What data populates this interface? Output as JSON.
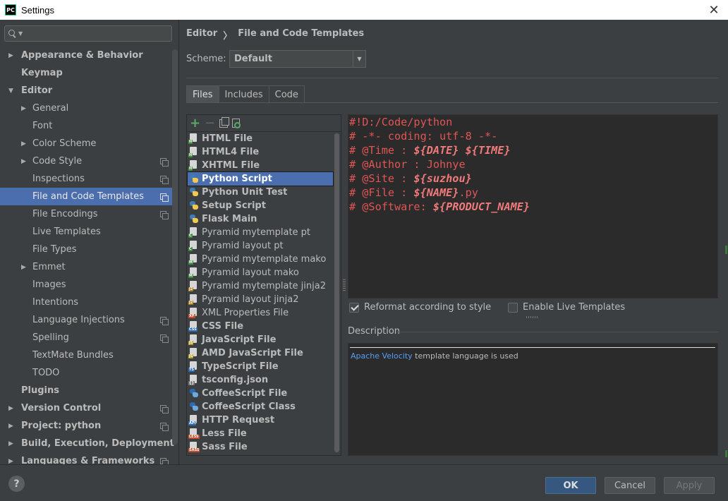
{
  "window": {
    "app_icon": "PC",
    "title": "Settings",
    "close_glyph": "✕"
  },
  "sidebar": {
    "search_placeholder": "",
    "items": [
      {
        "label": "Appearance & Behavior",
        "arrow": "▶"
      },
      {
        "label": "Keymap"
      },
      {
        "label": "Editor",
        "arrow": "▼"
      },
      {
        "label": "General",
        "arrow": "▶"
      },
      {
        "label": "Font"
      },
      {
        "label": "Color Scheme",
        "arrow": "▶"
      },
      {
        "label": "Code Style",
        "arrow": "▶"
      },
      {
        "label": "Inspections"
      },
      {
        "label": "File and Code Templates"
      },
      {
        "label": "File Encodings"
      },
      {
        "label": "Live Templates"
      },
      {
        "label": "File Types"
      },
      {
        "label": "Emmet",
        "arrow": "▶"
      },
      {
        "label": "Images"
      },
      {
        "label": "Intentions"
      },
      {
        "label": "Language Injections",
        "arrow": "▶"
      },
      {
        "label": "Spelling"
      },
      {
        "label": "TextMate Bundles"
      },
      {
        "label": "TODO"
      },
      {
        "label": "Plugins"
      },
      {
        "label": "Version Control",
        "arrow": "▶"
      },
      {
        "label": "Project: python",
        "arrow": "▶"
      },
      {
        "label": "Build, Execution, Deployment",
        "arrow": "▶"
      },
      {
        "label": "Languages & Frameworks",
        "arrow": "▶"
      }
    ],
    "help_label": "?"
  },
  "breadcrumb": {
    "parent": "Editor",
    "separator": "〉",
    "current": "File and Code Templates"
  },
  "scheme": {
    "label": "Scheme:",
    "value": "Default",
    "dropdown_glyph": "▼"
  },
  "tabs": [
    "Files",
    "Includes",
    "Code"
  ],
  "toolbar": {
    "add": "+",
    "remove": "−"
  },
  "templates": [
    {
      "label": "HTML File",
      "tag": "H"
    },
    {
      "label": "HTML4 File",
      "tag": "H"
    },
    {
      "label": "XHTML File",
      "tag": "H"
    },
    {
      "label": "Python Script",
      "tag": "py"
    },
    {
      "label": "Python Unit Test",
      "tag": "py"
    },
    {
      "label": "Setup Script",
      "tag": "py"
    },
    {
      "label": "Flask Main",
      "tag": "py"
    },
    {
      "label": "Pyramid mytemplate pt",
      "tag": "C"
    },
    {
      "label": "Pyramid layout pt",
      "tag": "C"
    },
    {
      "label": "Pyramid mytemplate mako",
      "tag": "M"
    },
    {
      "label": "Pyramid layout mako",
      "tag": "M"
    },
    {
      "label": "Pyramid mytemplate jinja2",
      "tag": "J2"
    },
    {
      "label": "Pyramid layout jinja2",
      "tag": "J2"
    },
    {
      "label": "XML Properties File",
      "tag": "XP"
    },
    {
      "label": "CSS File",
      "tag": "CSS"
    },
    {
      "label": "JavaScript File",
      "tag": "JS"
    },
    {
      "label": "AMD JavaScript File",
      "tag": "JS"
    },
    {
      "label": "TypeScript File",
      "tag": "TS"
    },
    {
      "label": "tsconfig.json",
      "tag": "{}"
    },
    {
      "label": "CoffeeScript File",
      "tag": "cf"
    },
    {
      "label": "CoffeeScript Class",
      "tag": "cf"
    },
    {
      "label": "HTTP Request",
      "tag": "API"
    },
    {
      "label": "Less File",
      "tag": "LESS"
    },
    {
      "label": "Sass File",
      "tag": "SASS"
    }
  ],
  "editor": {
    "lines": [
      {
        "text": "#!D:/Code/python"
      },
      {
        "text": "# -*- coding: utf-8 -*-"
      },
      {
        "text": "# @Time : ",
        "var": "${DATE}",
        "text2": " ",
        "var2": "${TIME}"
      },
      {
        "text": "# @Author : Johnye"
      },
      {
        "text": "# @Site : ",
        "var": "${suzhou}"
      },
      {
        "text": "# @File : ",
        "var": "${NAME}",
        "text2": ".py"
      },
      {
        "text": "# @Software: ",
        "var": "${PRODUCT_NAME}"
      }
    ]
  },
  "options": {
    "reformat": {
      "label": "Reformat according to style",
      "checked": true
    },
    "live_templates": {
      "label": "Enable Live Templates",
      "checked": false
    }
  },
  "description": {
    "label": "Description",
    "link": "Apache Velocity",
    "text": " template language is used"
  },
  "buttons": {
    "ok": "OK",
    "cancel": "Cancel",
    "apply": "Apply"
  },
  "colors": {
    "selection": "#4b6eaf",
    "background": "#3c3f41",
    "editor_bg": "#2b2b2b",
    "code_text": "#e05555",
    "link": "#589df6",
    "ok_button": "#365880"
  }
}
